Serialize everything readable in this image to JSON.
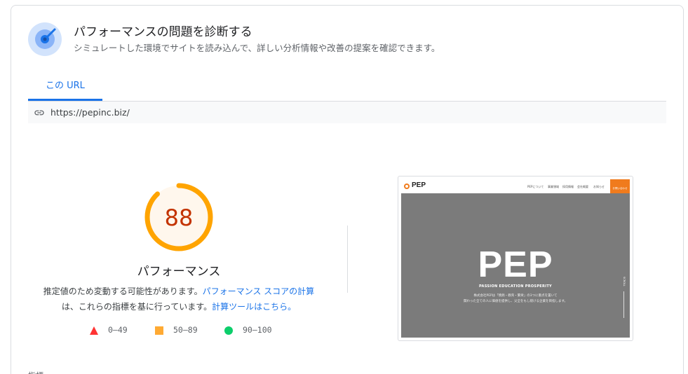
{
  "header": {
    "icon": "radar-icon",
    "title": "パフォーマンスの問題を診断する",
    "subtitle": "シミュレートした環境でサイトを読み込んで、詳しい分析情報や改善の提案を確認できます。"
  },
  "tabs": [
    {
      "label": "この URL",
      "active": true
    }
  ],
  "url_bar": {
    "icon": "link-icon",
    "url": "https://pepinc.biz/"
  },
  "score": {
    "value": "88",
    "fraction": 0.88,
    "label": "パフォーマンス",
    "color": "#ffa400",
    "text_color": "#c33300",
    "fill_color": "#fff7ed"
  },
  "description": {
    "text_1": "推定値のため変動する可能性があります。",
    "link_1": "パフォーマンス スコアの計算",
    "text_2": "は、これらの指標を基に行っています。",
    "link_2": "計算ツールはこちら。"
  },
  "legend": [
    {
      "shape": "triangle",
      "label": "0–49",
      "color": "#ff3333"
    },
    {
      "shape": "square",
      "label": "50–89",
      "color": "#ffaa33"
    },
    {
      "shape": "circle",
      "label": "90–100",
      "color": "#0cce6b"
    }
  ],
  "preview": {
    "logo": "PEP",
    "nav_items": [
      "PEPについて",
      "事業領域",
      "採用情報",
      "会社概要",
      "お知らせ"
    ],
    "cta": "お問い合わせ",
    "hero_title": "PEP",
    "hero_subtitle": "PASSION EDUCATION PROSPERITY",
    "hero_body_1": "株式会社PEPは「情熱・教育・繁栄」の3つに重点を置いて",
    "hero_body_2": "関わった全ての人に価値を提供し、父全をもし続ける企業を目指します。",
    "scroll": "SCROLL"
  },
  "bottom": {
    "text": "指標"
  }
}
